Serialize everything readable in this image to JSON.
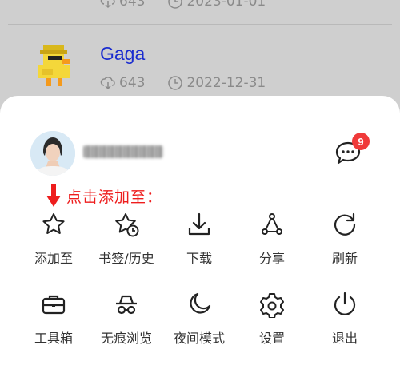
{
  "background_list": {
    "items": [
      {
        "title": "",
        "downloads": "643",
        "date": "2023-01-01"
      },
      {
        "title": "Gaga",
        "downloads": "643",
        "date": "2022-12-31"
      }
    ]
  },
  "menu": {
    "messages_badge": "9",
    "annotation": "点击添加至：",
    "row1": [
      {
        "label": "添加至",
        "icon": "star-icon"
      },
      {
        "label": "书签/历史",
        "icon": "star-clock-icon"
      },
      {
        "label": "下载",
        "icon": "download-icon"
      },
      {
        "label": "分享",
        "icon": "share-icon"
      },
      {
        "label": "刷新",
        "icon": "refresh-icon"
      }
    ],
    "row2": [
      {
        "label": "工具箱",
        "icon": "toolbox-icon"
      },
      {
        "label": "无痕浏览",
        "icon": "incognito-icon"
      },
      {
        "label": "夜间模式",
        "icon": "moon-icon"
      },
      {
        "label": "设置",
        "icon": "gear-icon"
      },
      {
        "label": "退出",
        "icon": "power-icon"
      }
    ]
  },
  "colors": {
    "accent_red": "#ee1d1d",
    "title_blue": "#1a2ccf",
    "badge_red": "#f03a3a"
  }
}
